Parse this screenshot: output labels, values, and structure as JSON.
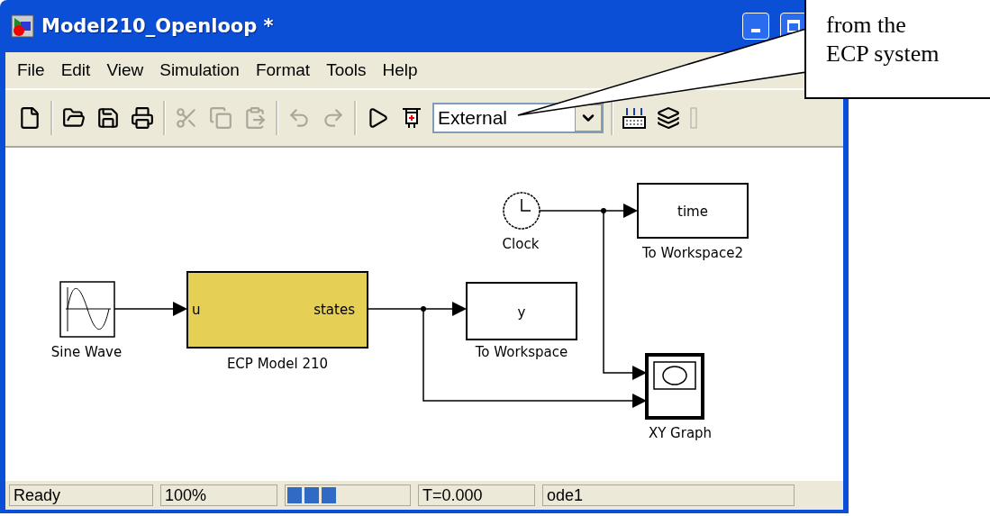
{
  "window": {
    "title": "Model210_Openloop *"
  },
  "menu": [
    "File",
    "Edit",
    "View",
    "Simulation",
    "Format",
    "Tools",
    "Help"
  ],
  "toolbar": [
    {
      "kind": "new",
      "disabled": false
    },
    {
      "kind": "separator"
    },
    {
      "kind": "open",
      "disabled": false
    },
    {
      "kind": "save",
      "disabled": false
    },
    {
      "kind": "print",
      "disabled": false
    },
    {
      "kind": "separator"
    },
    {
      "kind": "cut",
      "disabled": true
    },
    {
      "kind": "copy",
      "disabled": true
    },
    {
      "kind": "paste",
      "disabled": true
    },
    {
      "kind": "separator"
    },
    {
      "kind": "undo",
      "disabled": true
    },
    {
      "kind": "redo",
      "disabled": true
    },
    {
      "kind": "separator"
    },
    {
      "kind": "play",
      "disabled": false
    },
    {
      "kind": "external",
      "disabled": false
    },
    {
      "kind": "dropdown",
      "value": "External"
    },
    {
      "kind": "separator"
    },
    {
      "kind": "build",
      "disabled": false
    },
    {
      "kind": "update",
      "disabled": false
    },
    {
      "kind": "partial",
      "disabled": true
    }
  ],
  "diagram": {
    "blocks": [
      {
        "kind": "clock",
        "label": "Clock"
      },
      {
        "kind": "workspace",
        "text": "time",
        "label": "To Workspace2"
      },
      {
        "kind": "sine",
        "label": "Sine Wave"
      },
      {
        "kind": "subsystem",
        "input": "u",
        "output": "states",
        "label": "ECP Model 210"
      },
      {
        "kind": "workspace",
        "text": "y",
        "label": "To Workspace"
      },
      {
        "kind": "xygraph",
        "label": "XY Graph"
      }
    ]
  },
  "status_bar": [
    {
      "kind": "text",
      "text": "Ready"
    },
    {
      "kind": "text",
      "text": "100%"
    },
    {
      "kind": "progress"
    },
    {
      "kind": "text",
      "text": "T=0.000"
    },
    {
      "kind": "text",
      "text": "ode1"
    }
  ],
  "callout": {
    "lines": [
      "from the",
      "ECP system"
    ]
  }
}
